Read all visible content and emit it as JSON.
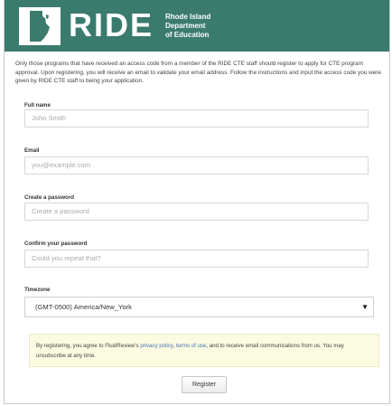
{
  "header": {
    "logo_text": "RIDE",
    "logo_sub": [
      "Rhode Island",
      "Department",
      "of Education"
    ],
    "brand_color": "#3a7b6e"
  },
  "intro_text": "Only those programs that have received an access code from a member of the RIDE CTE staff should register to apply for CTE program approval. Upon registering, you will receive an email to validate your email address. Follow the instructions and input the access code you were given by RIDE CTE staff to being your application.",
  "form": {
    "full_name": {
      "label": "Full name",
      "placeholder": "John Smith",
      "value": ""
    },
    "email": {
      "label": "Email",
      "placeholder": "you@example.com",
      "value": ""
    },
    "password": {
      "label": "Create a password",
      "placeholder": "Create a password",
      "value": ""
    },
    "confirm_password": {
      "label": "Confirm your password",
      "placeholder": "Could you repeat that?",
      "value": ""
    },
    "timezone": {
      "label": "Timezone",
      "selected": "(GMT-0500) America/New_York"
    }
  },
  "notice": {
    "prefix": "By registering, you agree to FluidReview's ",
    "privacy_link": "privacy policy",
    "separator": ", ",
    "terms_link": "terms of use",
    "suffix": ", and to receive email communications from us. You may unsubscribe at any time."
  },
  "register_button": "Register"
}
